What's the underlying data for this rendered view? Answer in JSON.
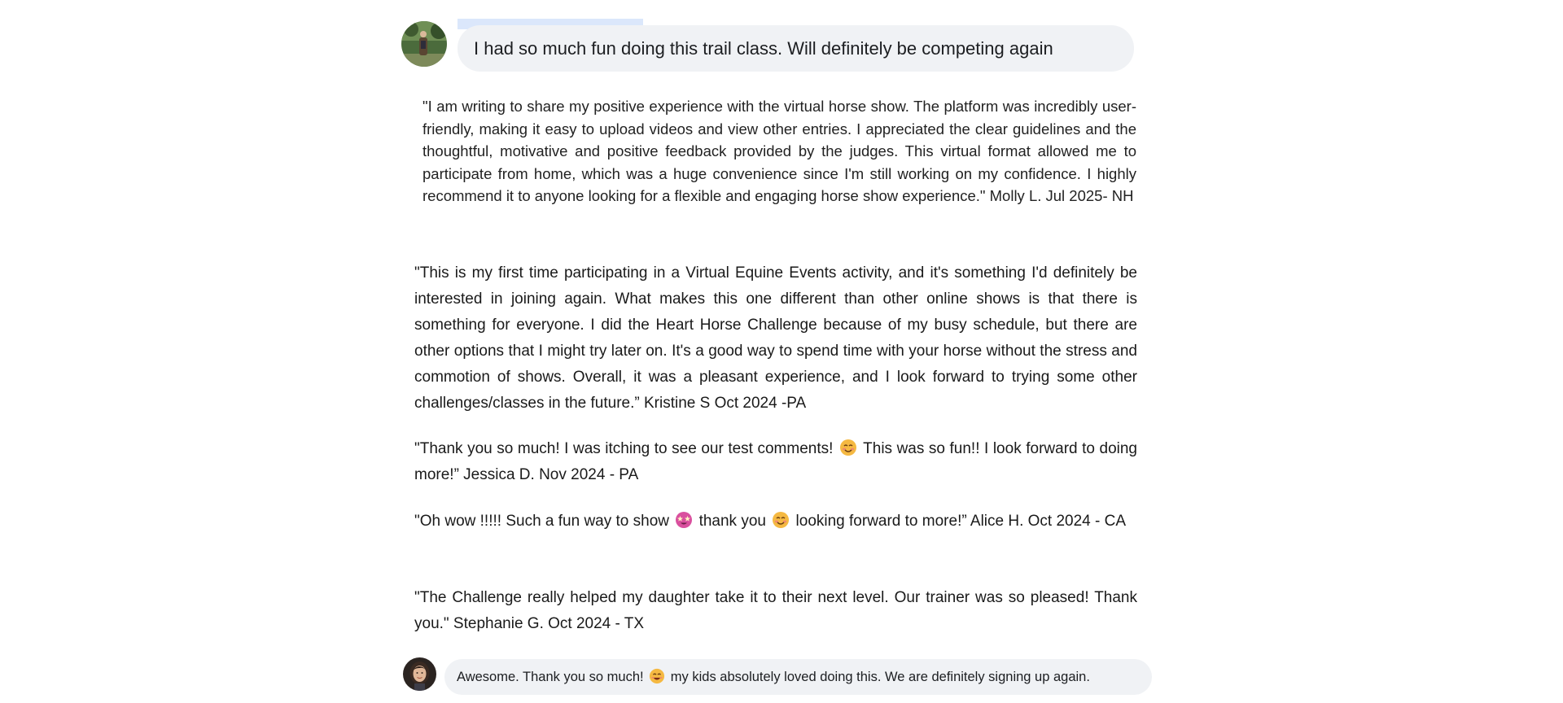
{
  "top_comment": {
    "avatar_icon": "rider-on-horse-avatar",
    "text": "I had so much fun doing this trail class. Will definitely be competing again"
  },
  "testimonials": [
    {
      "text": "\"I am writing to share my positive experience with the virtual horse show. The platform was incredibly user-friendly, making it easy to upload videos and view other entries. I appreciated the clear guidelines and the thoughtful, motivative and positive feedback provided by the judges. This virtual format allowed me to participate from home, which was a huge convenience since I'm still working on my confidence. I highly recommend it to anyone looking for a flexible and engaging horse show experience.\" Molly L. Jul 2025- NH"
    },
    {
      "text": "\"This is my first time participating in a Virtual Equine Events activity, and it's something I'd definitely be interested in joining again. What makes this one different than other online shows is that there is something for everyone. I did the Heart Horse Challenge because of my busy schedule, but there are other options that I might try later on. It's a good way to spend time with your horse without the stress and commotion of shows. Overall, it was a pleasant experience, and I look forward to trying some other challenges/classes in the future.” Kristine S Oct 2024 -PA"
    },
    {
      "text_before_emoji": "\"Thank you so much! I was itching to see our test comments!",
      "emoji": "smiling-face-icon",
      "text_after_emoji": "This was so fun!! I look forward to doing more!” Jessica D. Nov 2024 - PA"
    },
    {
      "text_part1": "\"Oh wow !!!!! Such a fun way to show",
      "emoji1": "star-struck-face-icon",
      "text_part2": "thank you",
      "emoji2": "smiling-face-icon",
      "text_part3": "looking forward to more!” Alice H. Oct 2024 - CA"
    },
    {
      "text": "\"The Challenge really helped my daughter take it to their next level. Our trainer was so pleased! Thank you.\" Stephanie G. Oct 2024 - TX"
    }
  ],
  "bottom_comment": {
    "avatar_icon": "woman-portrait-avatar",
    "text_before_emoji": "Awesome. Thank you so much!",
    "emoji": "grinning-face-icon",
    "text_after_emoji": "my kids absolutely loved doing this.  We are definitely signing up again."
  }
}
